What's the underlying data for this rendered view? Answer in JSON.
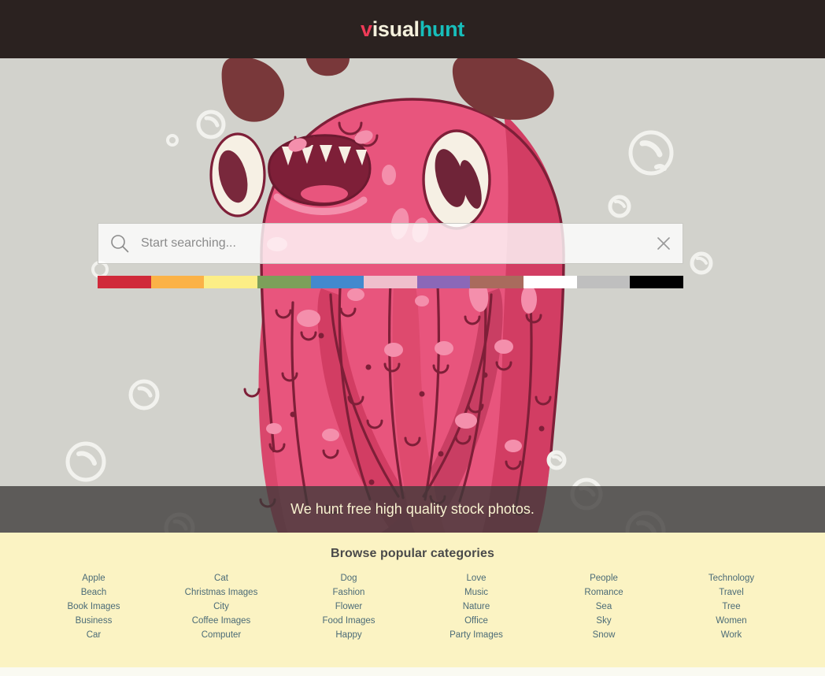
{
  "header": {
    "logo": {
      "part1": "v",
      "part2": "isual",
      "part3": "hunt"
    },
    "background_color": "#2B2220",
    "colors": {
      "part1": "#EE3B57",
      "part2": "#F4F0DC",
      "part3": "#17BEBB"
    }
  },
  "hero": {
    "background_color": "#D2D2CC",
    "illustration": "pink-monster-illustration"
  },
  "search": {
    "placeholder": "Start searching...",
    "value": "",
    "search_icon": "magnifier-icon",
    "clear_icon": "close-x-icon"
  },
  "color_filters": [
    {
      "name": "red",
      "hex": "#D0293A"
    },
    {
      "name": "orange",
      "hex": "#FBB247"
    },
    {
      "name": "yellow",
      "hex": "#FCEE86"
    },
    {
      "name": "green",
      "hex": "#7CA05A"
    },
    {
      "name": "blue",
      "hex": "#4289CE"
    },
    {
      "name": "pink",
      "hex": "#EFBFCC"
    },
    {
      "name": "purple",
      "hex": "#8B68B8"
    },
    {
      "name": "brown",
      "hex": "#A96B5D"
    },
    {
      "name": "white",
      "hex": "#FFFFFF"
    },
    {
      "name": "gray",
      "hex": "#BFBFBF"
    },
    {
      "name": "black",
      "hex": "#000000"
    }
  ],
  "tagline": {
    "text": "We hunt free high quality stock photos.",
    "text_color": "#F8F2D0",
    "band_color": "rgba(60,58,56,0.78)"
  },
  "categories": {
    "title": "Browse popular categories",
    "background_color": "#FBF3C3",
    "link_color": "#4B6B77",
    "columns": [
      {
        "items": [
          "Apple",
          "Beach",
          "Book Images",
          "Business",
          "Car"
        ]
      },
      {
        "items": [
          "Cat",
          "Christmas Images",
          "City",
          "Coffee Images",
          "Computer"
        ]
      },
      {
        "items": [
          "Dog",
          "Fashion",
          "Flower",
          "Food Images",
          "Happy"
        ]
      },
      {
        "items": [
          "Love",
          "Music",
          "Nature",
          "Office",
          "Party Images"
        ]
      },
      {
        "items": [
          "People",
          "Romance",
          "Sea",
          "Sky",
          "Snow"
        ]
      },
      {
        "items": [
          "Technology",
          "Travel",
          "Tree",
          "Women",
          "Work"
        ]
      }
    ]
  }
}
